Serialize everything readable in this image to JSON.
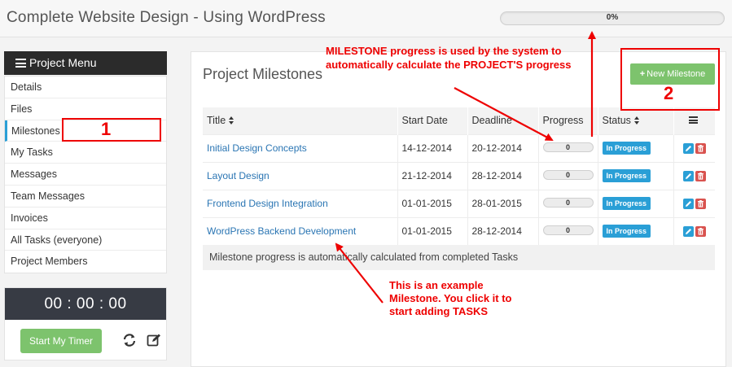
{
  "header": {
    "title": "Complete Website Design - Using WordPress",
    "progress_value": 0,
    "progress_label": "0%"
  },
  "sidebar": {
    "menu_title": "Project Menu",
    "items": [
      {
        "label": "Details"
      },
      {
        "label": "Files"
      },
      {
        "label": "Milestones",
        "active": true
      },
      {
        "label": "My Tasks"
      },
      {
        "label": "Messages"
      },
      {
        "label": "Team Messages"
      },
      {
        "label": "Invoices"
      },
      {
        "label": "All Tasks (everyone)"
      },
      {
        "label": "Project Members"
      }
    ],
    "timer": {
      "display": "00 : 00 : 00",
      "start_label": "Start My Timer",
      "icons": [
        "refresh-icon",
        "edit-icon"
      ]
    }
  },
  "main": {
    "title": "Project Milestones",
    "new_button_label": "New Milestone",
    "columns": [
      "Title",
      "Start Date",
      "Deadline",
      "Progress",
      "Status"
    ],
    "rows": [
      {
        "title": "Initial Design Concepts",
        "start": "14-12-2014",
        "deadline": "20-12-2014",
        "progress": "0",
        "status": "In Progress"
      },
      {
        "title": "Layout Design",
        "start": "21-12-2014",
        "deadline": "28-12-2014",
        "progress": "0",
        "status": "In Progress"
      },
      {
        "title": "Frontend Design Integration",
        "start": "01-01-2015",
        "deadline": "28-01-2015",
        "progress": "0",
        "status": "In Progress"
      },
      {
        "title": "WordPress Backend Development",
        "start": "01-01-2015",
        "deadline": "28-12-2014",
        "progress": "0",
        "status": "In Progress"
      }
    ],
    "footer_note": "Milestone progress is automatically calculated from completed Tasks"
  },
  "annotations": {
    "top_note_line1": "MILESTONE progress is used by the system to",
    "top_note_line2": "automatically calculate the PROJECT'S progress",
    "example_line1": "This is an example",
    "example_line2": "Milestone. You click it to",
    "example_line3": "start adding TASKS",
    "marker_1": "1",
    "marker_2": "2",
    "color": "#e00000"
  },
  "colors": {
    "accent": "#2a9fd6",
    "success": "#7dc36d",
    "danger": "#d9534f",
    "dark": "#2b2b2b",
    "timer_bg": "#373b44"
  }
}
